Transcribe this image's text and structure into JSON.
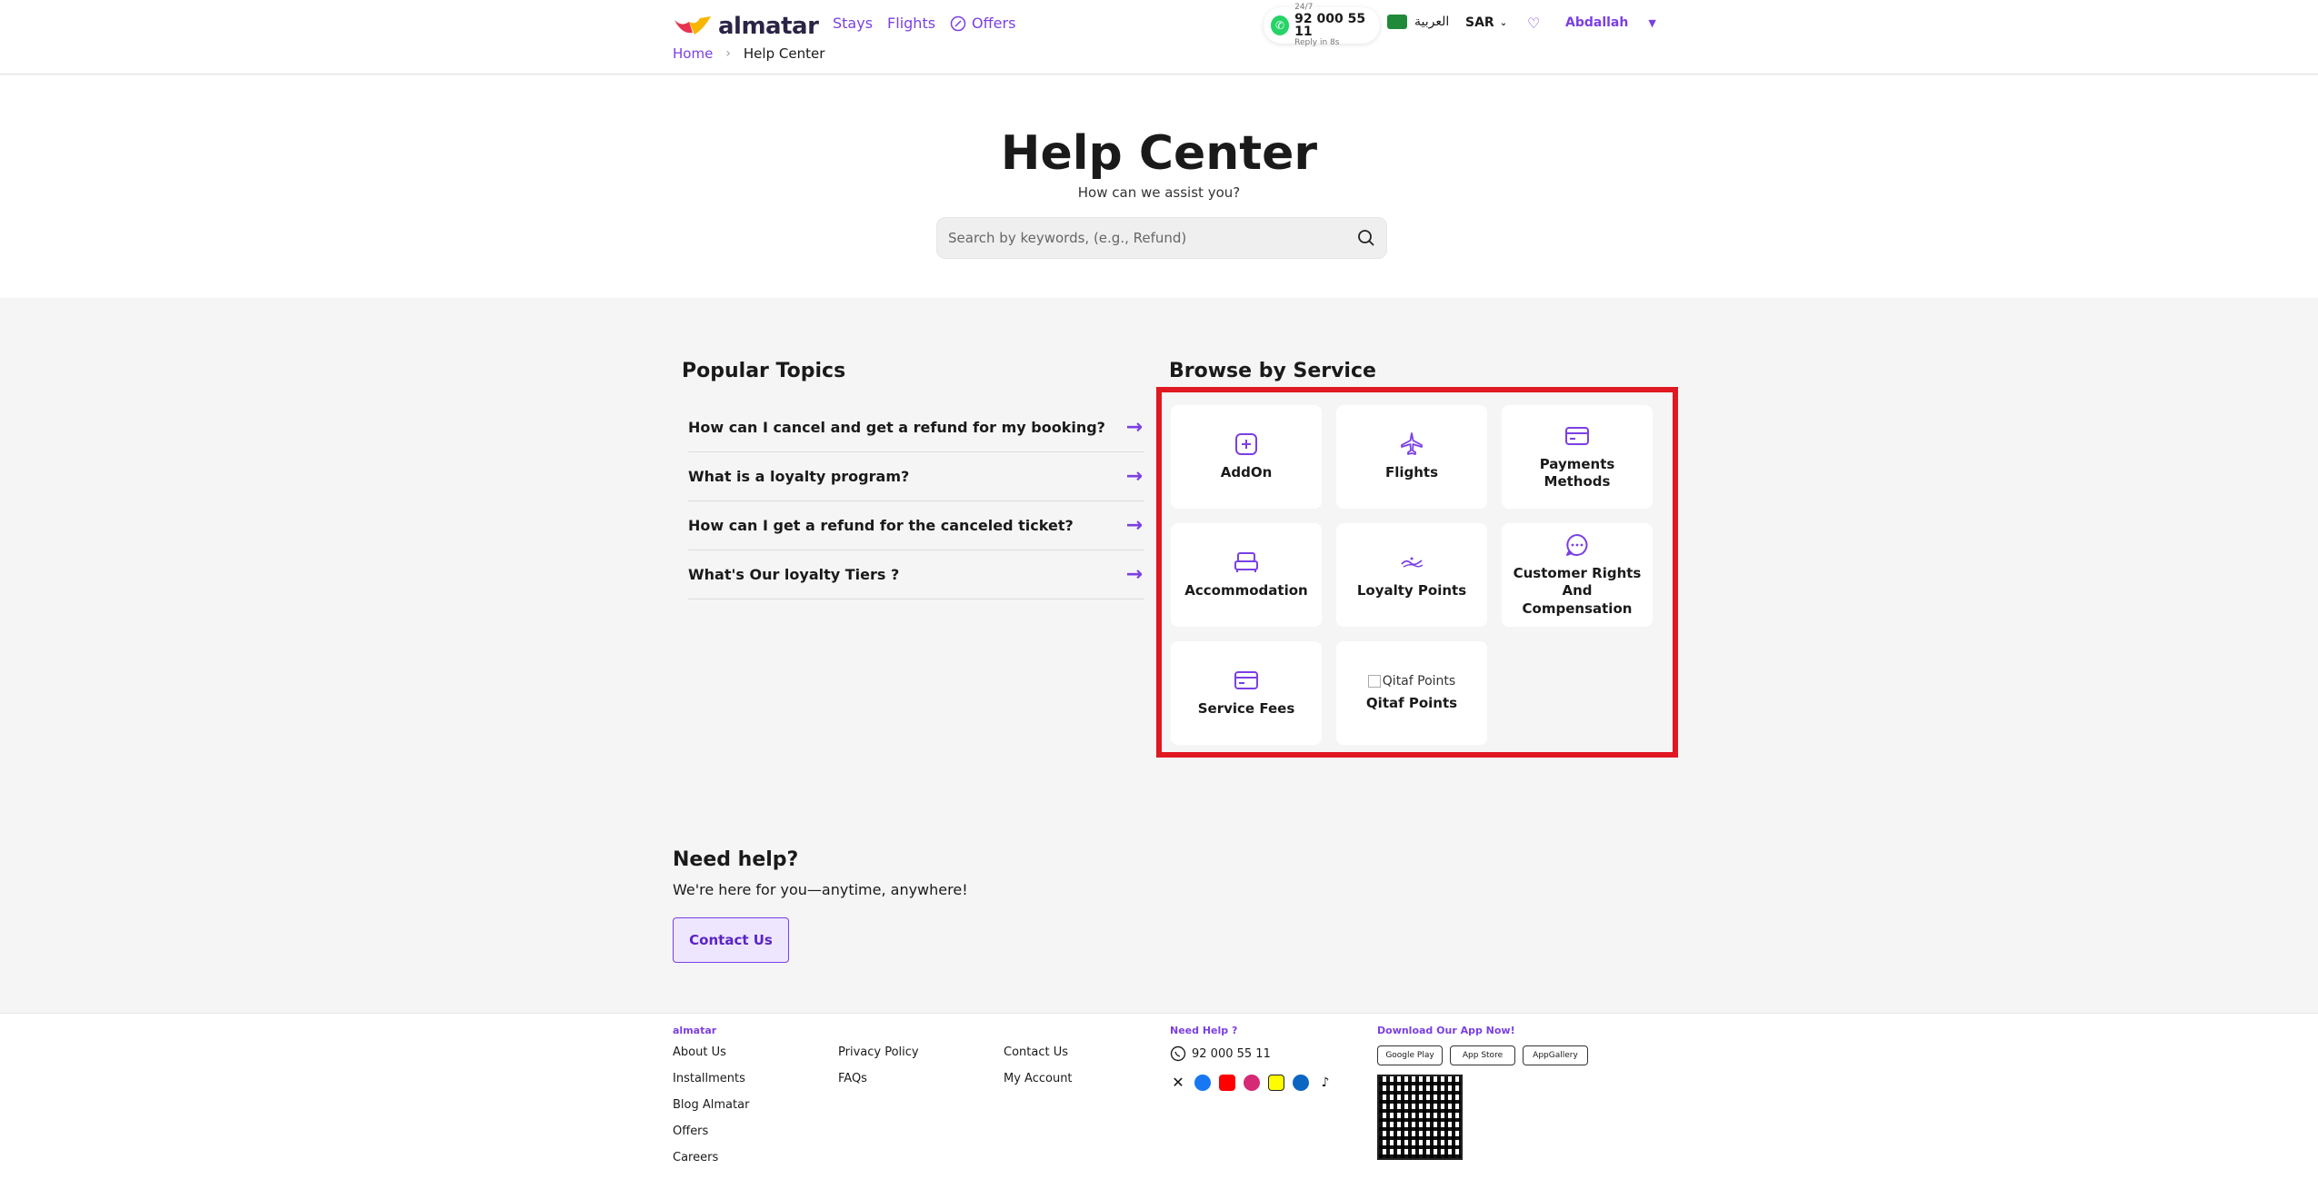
{
  "header": {
    "brand": "almatar",
    "nav": [
      "Stays",
      "Flights",
      "Offers"
    ],
    "whatsapp": {
      "label": "24/7",
      "number": "92 000 55 11",
      "note": "Reply in 8s"
    },
    "language": "العربية",
    "currency": "SAR",
    "user": "Abdallah"
  },
  "breadcrumb": {
    "home": "Home",
    "current": "Help Center"
  },
  "hero": {
    "title": "Help Center",
    "subtitle": "How can we assist you?",
    "search_placeholder": "Search by keywords, (e.g., Refund)"
  },
  "popular": {
    "title": "Popular Topics",
    "topics": [
      "How can I cancel and get a refund for my booking?",
      "What is a loyalty program?",
      "How can I get a refund for the canceled ticket?",
      "What's Our loyalty Tiers ?"
    ]
  },
  "browse": {
    "title": "Browse by Service",
    "services": [
      {
        "label": "AddOn",
        "icon": "plus-square-icon"
      },
      {
        "label": "Flights",
        "icon": "plane-icon"
      },
      {
        "label": "Payments Methods",
        "icon": "credit-card-icon"
      },
      {
        "label": "Accommodation",
        "icon": "bed-icon"
      },
      {
        "label": "Loyalty Points",
        "icon": "alfursan-logo-icon"
      },
      {
        "label": "Customer Rights And Compensation",
        "icon": "chat-bubble-icon"
      },
      {
        "label": "Service Fees",
        "icon": "credit-card-icon"
      },
      {
        "label": "Qitaf Points",
        "icon": "broken-image-icon",
        "alt": "Qitaf Points"
      }
    ]
  },
  "need_help": {
    "title": "Need help?",
    "subtitle": "We're here for you—anytime, anywhere!",
    "button": "Contact Us"
  },
  "footer": {
    "col1_head": "almatar",
    "col1": [
      "About Us",
      "Installments",
      "Blog Almatar",
      "Offers",
      "Careers"
    ],
    "col2": [
      "Privacy Policy",
      "FAQs"
    ],
    "col3": [
      "Contact Us",
      "My Account"
    ],
    "help_head": "Need Help ?",
    "help_number": "92 000 55 11",
    "app_head": "Download Our App Now!",
    "stores": [
      "Google Play",
      "App Store",
      "AppGallery"
    ]
  },
  "colors": {
    "accent": "#7b3fe4",
    "highlight": "#e01822"
  }
}
